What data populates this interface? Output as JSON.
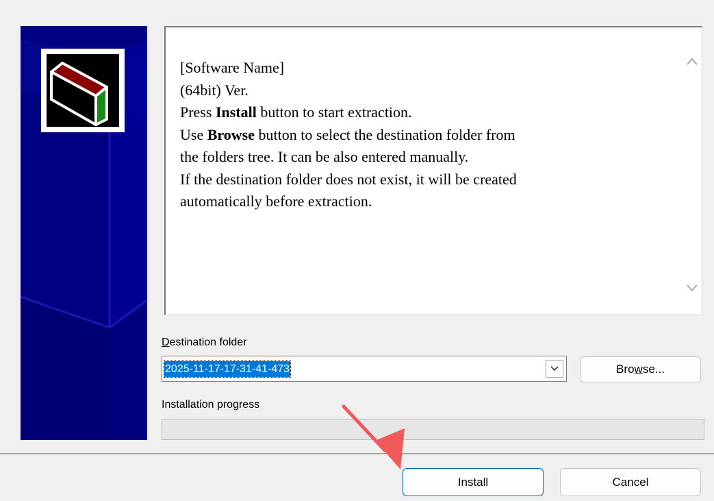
{
  "readme": {
    "line1": "[Software Name]",
    "line2": "(64bit) Ver.",
    "line3_pre": "Press ",
    "line3_bold": "Install",
    "line3_post": " button to start extraction.",
    "line4_pre": "Use ",
    "line4_bold": "Browse",
    "line4_post": " button to select the destination folder from",
    "line5": "the folders tree. It can be also entered manually.",
    "line6": "If the destination folder does not exist, it will be created",
    "line7": "automatically before extraction."
  },
  "destination": {
    "label_first": "D",
    "label_rest": "estination folder",
    "value": "2025-11-17-17-31-41-473"
  },
  "browse": {
    "pre": "Bro",
    "underline": "w",
    "post": "se..."
  },
  "progress": {
    "label": "Installation progress",
    "value": 0
  },
  "buttons": {
    "install": "Install",
    "cancel": "Cancel"
  },
  "colors": {
    "side_panel": "#000080",
    "selection": "#0078d7",
    "accent": "#0067c0",
    "annotation_arrow": "#f05a5a"
  }
}
